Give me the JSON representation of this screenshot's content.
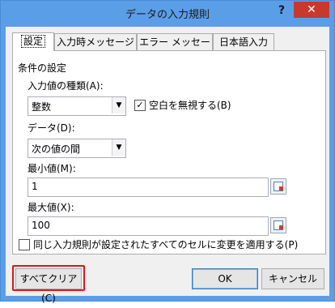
{
  "window": {
    "title": "データの入力規則",
    "help": "?",
    "close": "✕"
  },
  "tabs": [
    {
      "label": "設定"
    },
    {
      "label": "入力時メッセージ"
    },
    {
      "label": "エラー メッセージ"
    },
    {
      "label": "日本語入力"
    }
  ],
  "settings": {
    "group_label": "条件の設定",
    "type_label": "入力値の種類(A):",
    "type_value": "整数",
    "ignore_blank_label": "空白を無視する(B)",
    "ignore_blank_checked": "✓",
    "data_label": "データ(D):",
    "data_value": "次の値の間",
    "min_label": "最小値(M):",
    "min_value": "1",
    "max_label": "最大値(X):",
    "max_value": "100",
    "apply_all_label": "同じ入力規則が設定されたすべてのセルに変更を適用する(P)"
  },
  "buttons": {
    "clear_all": "すべてクリア(C)",
    "ok": "OK",
    "cancel": "キャンセル"
  },
  "colors": {
    "titlebar": "#5b9ee8",
    "close": "#c7392d",
    "highlight": "#e0141b"
  }
}
